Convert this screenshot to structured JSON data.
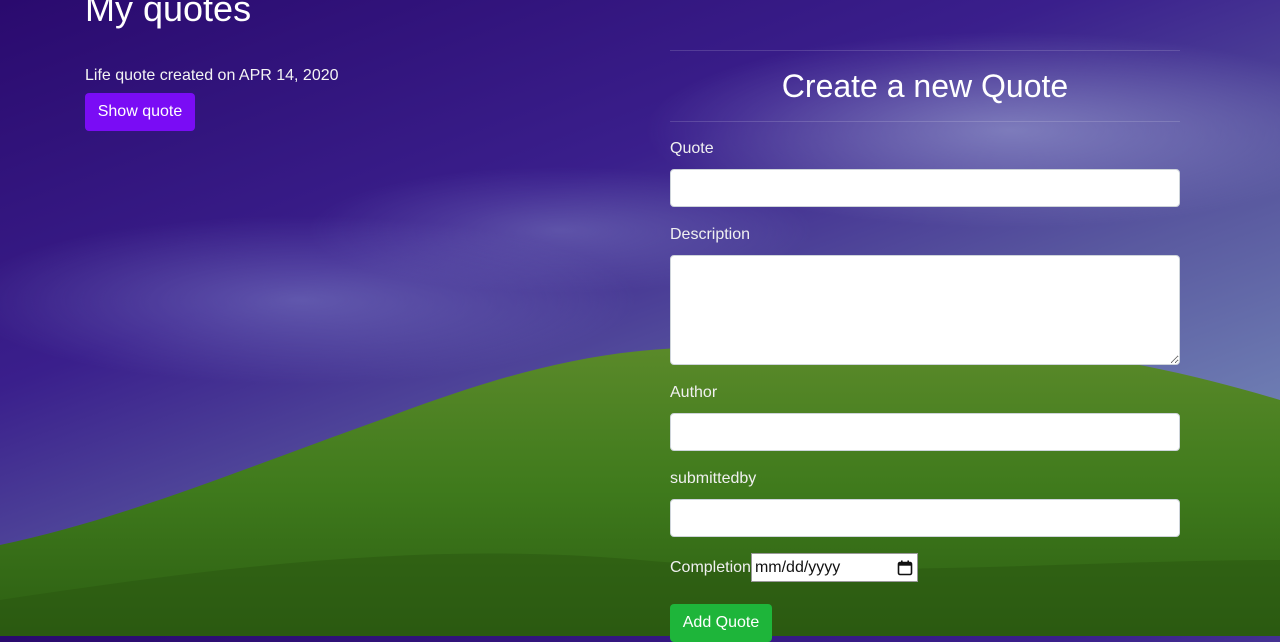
{
  "page": {
    "title": "My quotes"
  },
  "quotes": [
    {
      "meta": "Life quote created on APR 14, 2020",
      "button_label": "Show quote"
    }
  ],
  "form": {
    "heading": "Create a new Quote",
    "quote_label": "Quote",
    "description_label": "Description",
    "author_label": "Author",
    "submittedby_label": "submittedby",
    "completion_label": "Completion",
    "date_placeholder": "mm/dd/yyyy",
    "submit_label": "Add Quote"
  },
  "colors": {
    "show_button": "#7a0cf5",
    "add_button": "#1eb53a"
  },
  "icons": {
    "calendar": "calendar-icon"
  }
}
